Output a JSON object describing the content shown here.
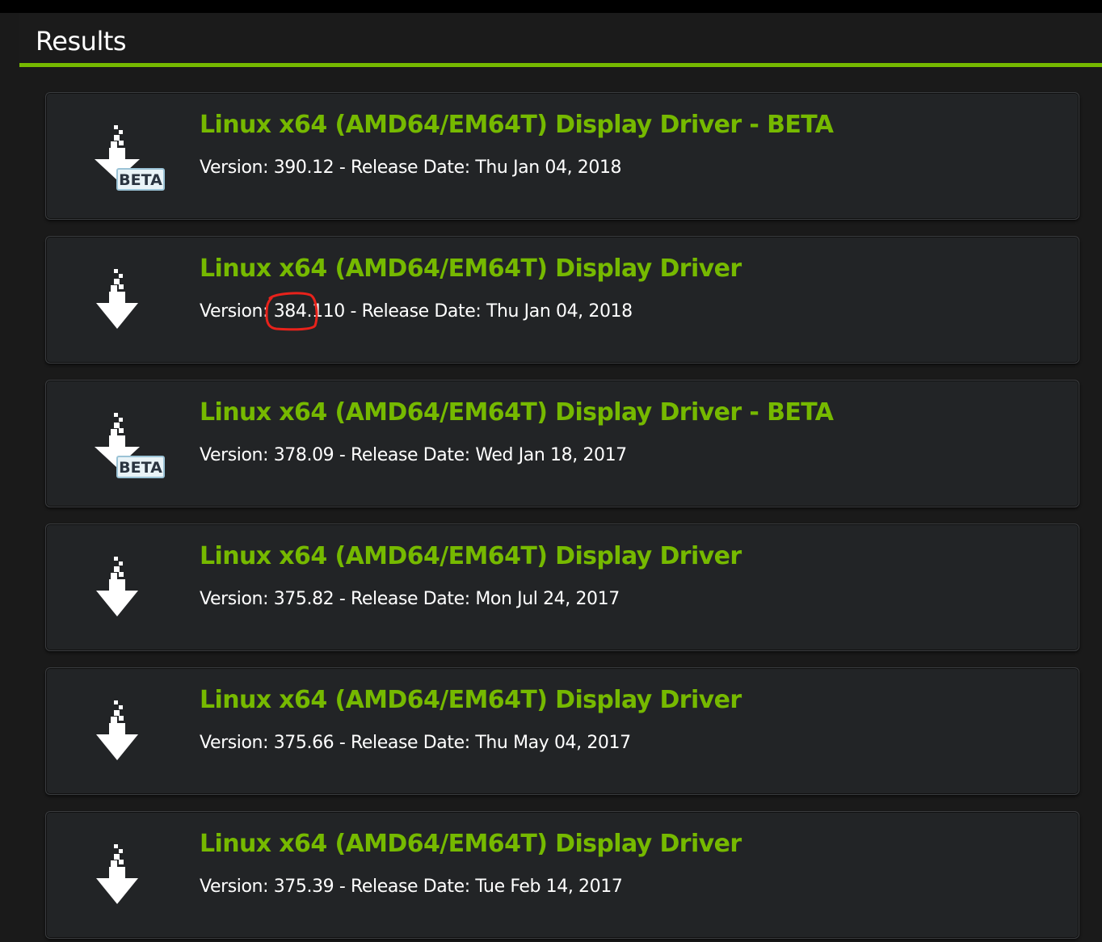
{
  "header": {
    "title": "Results",
    "accent_color": "#76b900"
  },
  "results": [
    {
      "title": "Linux x64 (AMD64/EM64T) Display Driver - BETA",
      "meta": "Version: 390.12 - Release Date: Thu Jan 04, 2018",
      "icon": "download-beta-icon",
      "badge": "BETA"
    },
    {
      "title": "Linux x64 (AMD64/EM64T) Display Driver",
      "meta": "Version: 384.110 - Release Date: Thu Jan 04, 2018",
      "icon": "download-icon",
      "badge": ""
    },
    {
      "title": "Linux x64 (AMD64/EM64T) Display Driver - BETA",
      "meta": "Version: 378.09 - Release Date: Wed Jan 18, 2017",
      "icon": "download-beta-icon",
      "badge": "BETA"
    },
    {
      "title": "Linux x64 (AMD64/EM64T) Display Driver",
      "meta": "Version: 375.82 - Release Date: Mon Jul 24, 2017",
      "icon": "download-icon",
      "badge": ""
    },
    {
      "title": "Linux x64 (AMD64/EM64T) Display Driver",
      "meta": "Version: 375.66 - Release Date: Thu May 04, 2017",
      "icon": "download-icon",
      "badge": ""
    },
    {
      "title": "Linux x64 (AMD64/EM64T) Display Driver",
      "meta": "Version: 375.39 - Release Date: Tue Feb 14, 2017",
      "icon": "download-icon",
      "badge": ""
    }
  ],
  "colors": {
    "title": "#76b900",
    "text": "#ffffff",
    "card_bg": "#222426",
    "page_bg": "#1a1a1a",
    "annotation": "#e8221b"
  }
}
